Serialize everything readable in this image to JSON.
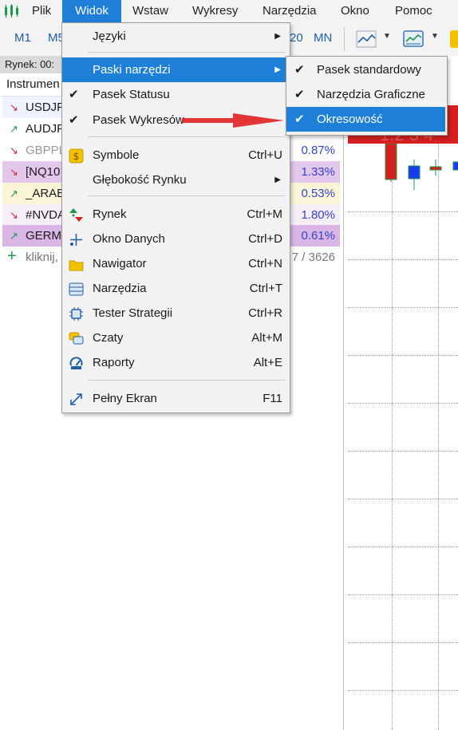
{
  "menubar": {
    "items": [
      "Plik",
      "Widok",
      "Wstaw",
      "Wykresy",
      "Narzędzia",
      "Okno",
      "Pomoc"
    ]
  },
  "toolbar": {
    "timeframes": [
      "M1",
      "M5",
      "20",
      "MN"
    ]
  },
  "market_watch": {
    "title": "Rynek: 00:",
    "column_header": "Instrumen",
    "rows": [
      {
        "symbol": "USDJP",
        "pct": "",
        "trend": "down",
        "bg": "#eef3ff"
      },
      {
        "symbol": "AUDJP",
        "pct": "",
        "trend": "up",
        "bg": "#ffffff"
      },
      {
        "symbol": "GBPPL",
        "pct": "0.87%",
        "trend": "down",
        "bg": "#ffffff"
      },
      {
        "symbol": "[NQ10",
        "pct": "1.33%",
        "trend": "down",
        "bg": "#e3c8ec"
      },
      {
        "symbol": "_ARAB",
        "pct": "0.53%",
        "trend": "up",
        "bg": "#fbf5d8"
      },
      {
        "symbol": "#NVDA",
        "pct": "1.80%",
        "trend": "down",
        "bg": "#f6eef7"
      },
      {
        "symbol": "GERM",
        "pct": "0.61%",
        "trend": "up",
        "bg": "#d9b6e6"
      }
    ],
    "add_row": {
      "label": "kliknij,",
      "count": "7 / 3626"
    }
  },
  "chart": {
    "banner_text": "1.2 5 4"
  },
  "view_menu": {
    "items": [
      {
        "label": "Języki",
        "shortcut": "",
        "check": false,
        "icon": "",
        "submenu": true
      },
      {
        "label": "Paski narzędzi",
        "shortcut": "",
        "check": false,
        "icon": "",
        "submenu": true,
        "highlighted": true
      },
      {
        "label": "Pasek Statusu",
        "shortcut": "",
        "check": true,
        "icon": ""
      },
      {
        "label": "Pasek Wykresów",
        "shortcut": "",
        "check": true,
        "icon": ""
      },
      {
        "label": "Symbole",
        "shortcut": "Ctrl+U",
        "icon": "dollar-icon"
      },
      {
        "label": "Głębokość Rynku",
        "shortcut": "",
        "icon": "",
        "submenu": true
      },
      {
        "label": "Rynek",
        "shortcut": "Ctrl+M",
        "icon": "market-icon"
      },
      {
        "label": "Okno Danych",
        "shortcut": "Ctrl+D",
        "icon": "crosshair-icon"
      },
      {
        "label": "Nawigator",
        "shortcut": "Ctrl+N",
        "icon": "folder-icon"
      },
      {
        "label": "Narzędzia",
        "shortcut": "Ctrl+T",
        "icon": "toolbox-icon"
      },
      {
        "label": "Tester Strategii",
        "shortcut": "Ctrl+R",
        "icon": "chip-icon"
      },
      {
        "label": "Czaty",
        "shortcut": "Alt+M",
        "icon": "chat-icon"
      },
      {
        "label": "Raporty",
        "shortcut": "Alt+E",
        "icon": "report-icon"
      },
      {
        "label": "Pełny Ekran",
        "shortcut": "F11",
        "icon": "fullscreen-icon"
      }
    ]
  },
  "toolbars_submenu": {
    "items": [
      {
        "label": "Pasek standardowy",
        "check": true
      },
      {
        "label": "Narzędzia Graficzne",
        "check": true
      },
      {
        "label": "Okresowość",
        "check": true,
        "highlighted": true
      }
    ]
  },
  "annotation": {
    "arrow_color": "#e02020"
  },
  "colors": {
    "accent": "#1e7fd9",
    "bear": "#d62020",
    "bull": "#1a3cf0"
  }
}
